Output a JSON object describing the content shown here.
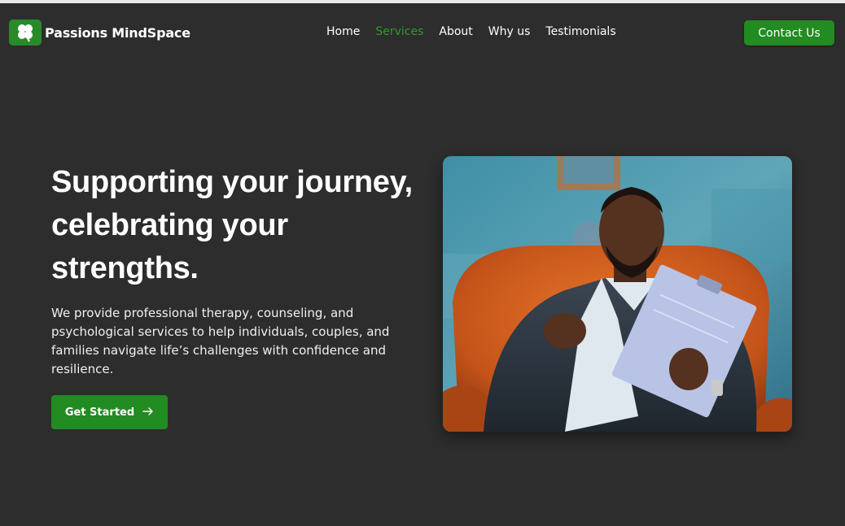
{
  "brand": {
    "name": "Passions MindSpace",
    "logo_icon": "clover-icon",
    "accent": "#228b22",
    "active_nav_color": "#2f9a2f",
    "background": "#2d2d2d"
  },
  "nav": {
    "items": [
      {
        "label": "Home",
        "active": false
      },
      {
        "label": "Services",
        "active": true
      },
      {
        "label": "About",
        "active": false
      },
      {
        "label": "Why us",
        "active": false
      },
      {
        "label": "Testimonials",
        "active": false
      }
    ]
  },
  "header": {
    "contact_label": "Contact Us"
  },
  "hero": {
    "title": "Supporting your journey, celebrating your strengths.",
    "description": "We provide professional therapy, counseling, and psychological services to help individuals, couples, and families navigate life’s challenges with confidence and resilience.",
    "cta_label": "Get Started",
    "cta_icon": "arrow-right-icon",
    "image_subject": "therapist-photo"
  }
}
